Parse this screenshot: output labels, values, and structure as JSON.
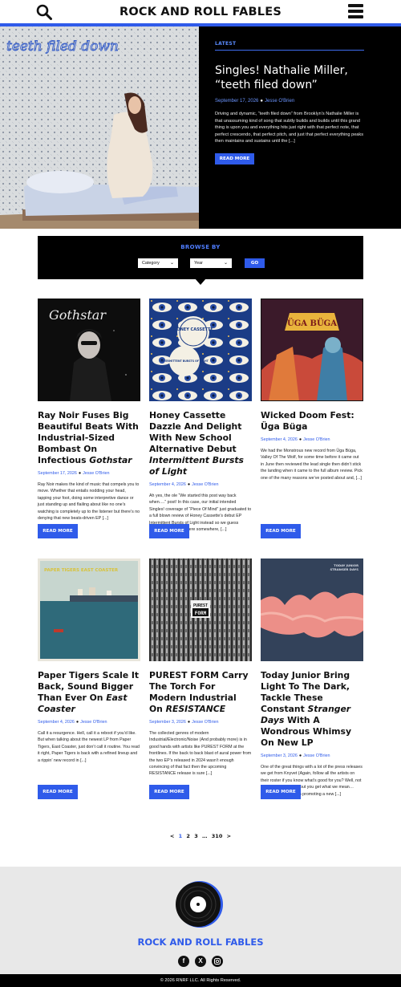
{
  "header": {
    "site_name": "ROCK AND ROLL FABLES"
  },
  "hero": {
    "label": "LATEST",
    "image_text": "teeth filed down",
    "title": "Singles! Nathalie Miller, “teeth filed down”",
    "date": "September 17, 2026",
    "author": "Jesse O'Brien",
    "excerpt": "Driving and dynamic, “teeth filed down” from Brooklyn’s Nathalie Miller is that unassuming kind of song that subtly builds and builds until this grand thing is upon you and everything hits just right with that perfect note, that perfect crescendo, that perfect pitch, and just that perfect everything peaks then maintains and sustains until the [...]",
    "button": "READ MORE"
  },
  "browse": {
    "title": "BROWSE BY",
    "category_value": "Category",
    "year_value": "Year",
    "go": "GO"
  },
  "cards": [
    {
      "title_main": "Ray Noir Fuses Big Beautiful Beats With Industrial-Sized Bombast On Infectious ",
      "title_em": "Gothstar",
      "thumb_text": "Gothstar",
      "date": "September 17, 2026",
      "author": "Jesse O'Brien",
      "excerpt": "Ray Noir makes the kind of music that compels you to move. Whether that entails nodding your head, tapping your foot, doing some interpretive dance or just standing up and flailing about like no one’s watching is completely up to the listener but there’s no denying that new beats-driven EP [...]",
      "button": "READ MORE"
    },
    {
      "title_main": "Honey Cassette Dazzle And Delight With New School Alternative Debut ",
      "title_em": "Intermittent Bursts of Light",
      "thumb_text_1": "HONEY CASSETTE",
      "thumb_text_2": "INTERMITTENT BURSTS OF LIGHT",
      "date": "September 4, 2026",
      "author": "Jesse O'Brien",
      "excerpt": "Ah yes, the ole “We started this post way back when….” post! In this case, our initial intended Singles! coverage of “Piece Of Mind” just graduated to a full blown review of Honey Cassette’s debut EP Intermittent Bursts of Light instead so we guess there’s a positive in here somewhere, [...]",
      "button": "READ MORE"
    },
    {
      "title_main": "Wicked Doom Fest: Üga Büga",
      "title_em": "",
      "thumb_text": "ÜGA BÜGA",
      "date": "September 4, 2026",
      "author": "Jesse O'Brien",
      "excerpt": "We had the Monstrous new record from Üga Büga, Valley Of The Wolf, for some time before it came out in June then reviewed the lead single then didn’t stick the landing when it came to the full album review. Pick one of the many reasons we’ve posted about and, [...]",
      "button": "READ MORE"
    },
    {
      "title_main": "Paper Tigers Scale It Back, Sound Bigger Than Ever On ",
      "title_em": "East Coaster",
      "thumb_text": "PAPER TIGERS EAST COASTER",
      "date": "September 4, 2026",
      "author": "Jesse O'Brien",
      "excerpt": "Call it a resurgence. Hell, call it a reboot if you’d like. But when talking about the newest LP from Paper Tigers, East Coaster, just don’t call it routine. You read it right, Paper Tigers is back with a refined lineup and a rippin’ new record in [...]",
      "button": "READ MORE"
    },
    {
      "title_main": "PUREST FORM Carry The Torch For Modern Industrial On ",
      "title_em": "RESISTANCE",
      "thumb_text_1": "PUREST",
      "thumb_text_2": "FORM",
      "date": "September 3, 2026",
      "author": "Jesse O'Brien",
      "excerpt": "The collected genres of modern Industrial/Electronic/Noise (And probably more) is in good hands with artists like PUREST FORM at the frontlines. If the back to back blast of aural power from the two EP’s released in 2024 wasn’t enough convincing of that fact then the upcoming RESISTANCE release is sure [...]",
      "button": "READ MORE"
    },
    {
      "title_main": "Today Junior Bring Light To The Dark, Tackle These Constant ",
      "title_em": "Stranger Days",
      "title_tail": " With A Wondrous Whimsy On New LP",
      "thumb_text_1": "TODAY JUNIOR",
      "thumb_text_2": "STRANGER DAYS",
      "date": "September 3, 2026",
      "author": "Jesse O'Brien",
      "excerpt": "One of the great things with a lot of the press releases we get from Knyvet (Again, follow all the artists on their roster if you know what’s good for you? Well, not as menacing as that but you get what we mean… right???) is that when promoting a new [...]",
      "button": "READ MORE"
    }
  ],
  "pagination": {
    "prev": "<",
    "current": "1",
    "p2": "2",
    "p3": "3",
    "ellipsis": "…",
    "last": "310",
    "next": ">"
  },
  "footer": {
    "site_name": "ROCK AND ROLL FABLES",
    "copyright": "© 2026 RNRF LLC. All Rights Reserved.",
    "social": [
      "f",
      "X",
      "ig"
    ]
  },
  "colors": {
    "accent": "#2f5bea",
    "hero_bg": "#000000",
    "footer_bg": "#e8e8e8"
  },
  "icons": [
    "search-icon",
    "menu-icon",
    "vinyl-logo-icon",
    "facebook-icon",
    "x-icon",
    "instagram-icon",
    "chevron-down-icon"
  ]
}
